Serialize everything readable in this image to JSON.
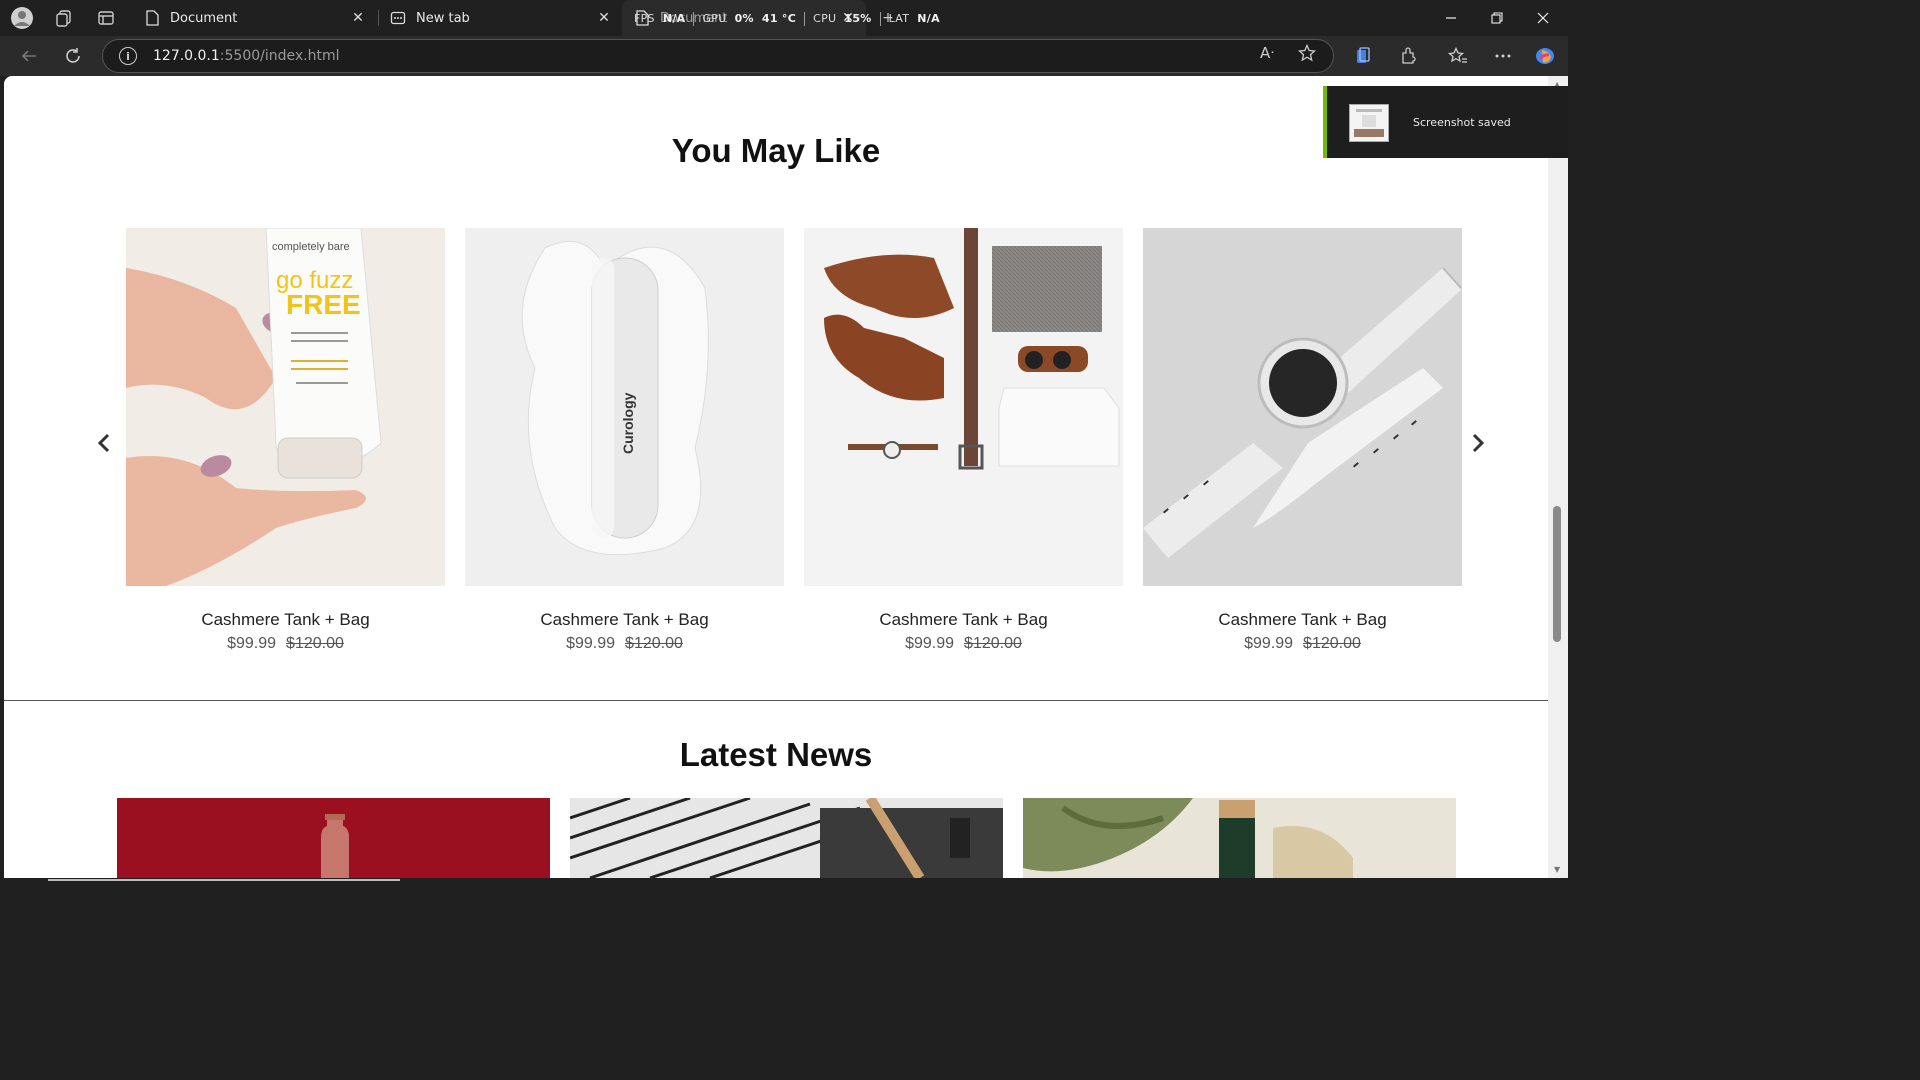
{
  "browser": {
    "tabs": [
      {
        "title": "Document",
        "active": false
      },
      {
        "title": "New tab",
        "active": false
      },
      {
        "title": "Document",
        "active": true
      }
    ],
    "address": {
      "host": "127.0.0.1",
      "path": ":5500/index.html"
    },
    "read_aloud_label": "A",
    "osd": {
      "fps_label": "FPS",
      "fps_value": "N/A",
      "gpu_label": "GPU",
      "gpu_value": "0%",
      "gpu_temp": "41 °C",
      "cpu_label": "CPU",
      "cpu_value": "15%",
      "lat_label": "LAT",
      "lat_value": "N/A"
    }
  },
  "toast": {
    "message": "Screenshot saved"
  },
  "recommend": {
    "title": "You May Like",
    "products": [
      {
        "name": "Cashmere Tank + Bag",
        "price": "$99.99",
        "old_price": "$120.00",
        "image": "tube-hand-photo",
        "brand": "completely bare",
        "tagline1": "go fuzz",
        "tagline2": "FREE"
      },
      {
        "name": "Cashmere Tank + Bag",
        "price": "$99.99",
        "old_price": "$120.00",
        "image": "bottle-splash-photo",
        "brand": "Curology"
      },
      {
        "name": "Cashmere Tank + Bag",
        "price": "$99.99",
        "old_price": "$120.00",
        "image": "flatlay-outfit-photo"
      },
      {
        "name": "Cashmere Tank + Bag",
        "price": "$99.99",
        "old_price": "$120.00",
        "image": "smartwatch-photo"
      }
    ]
  },
  "news": {
    "title": "Latest News",
    "items": [
      {
        "image": "red-bottle-photo"
      },
      {
        "image": "striped-fabric-photo"
      },
      {
        "image": "olive-bottle-photo"
      }
    ]
  },
  "colors": {
    "accent_toast": "#76b900",
    "tab_bar": "#202020"
  }
}
